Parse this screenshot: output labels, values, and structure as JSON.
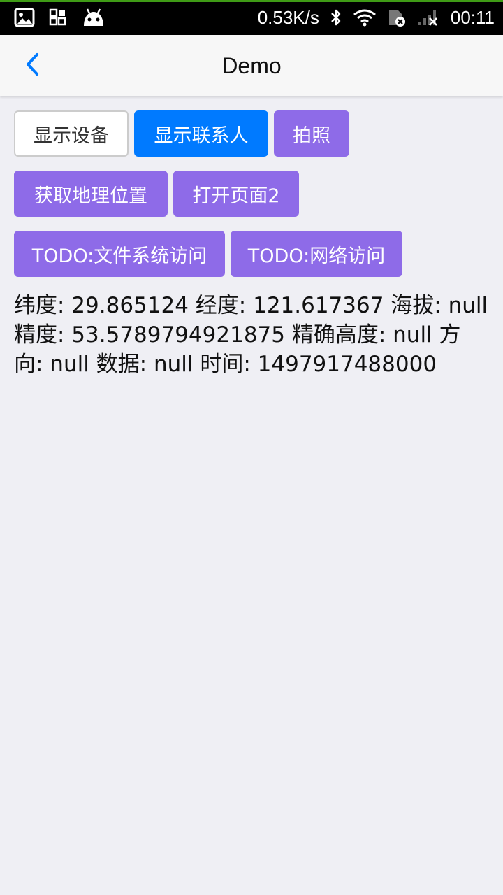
{
  "status_bar": {
    "network_speed": "0.53K/s",
    "time": "00:11",
    "colors": {
      "background": "#000000",
      "text": "#ffffff",
      "accent_line": "#3f9b16"
    },
    "icons": [
      "gallery-icon",
      "grid-app-icon",
      "android-icon",
      "bluetooth-icon",
      "wifi-icon",
      "sim-disabled-icon",
      "signal-icon"
    ]
  },
  "nav": {
    "title": "Demo",
    "back_icon": "chevron-left-icon",
    "accent": "#007aff"
  },
  "buttons": {
    "row1": [
      {
        "label": "显示设备",
        "style": "default"
      },
      {
        "label": "显示联系人",
        "style": "primary"
      },
      {
        "label": "拍照",
        "style": "purple"
      }
    ],
    "row2": [
      {
        "label": "获取地理位置",
        "style": "purple"
      },
      {
        "label": "打开页面2",
        "style": "purple"
      }
    ],
    "row3": [
      {
        "label": "TODO:文件系统访问",
        "style": "purple"
      },
      {
        "label": "TODO:网络访问",
        "style": "purple"
      }
    ]
  },
  "geo_info": {
    "text": "纬度: 29.865124 经度: 121.617367 海拔: null 精度: 53.5789794921875 精确高度: null 方向: null 数据: null 时间: 1497917488000"
  },
  "colors": {
    "page_background": "#efeff4",
    "primary_blue": "#007aff",
    "purple": "#8e6be8"
  }
}
